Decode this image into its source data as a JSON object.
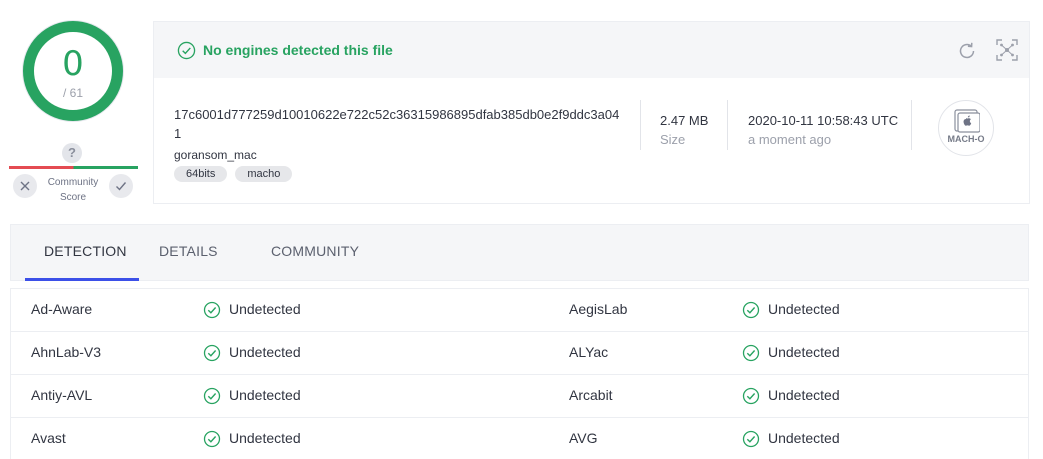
{
  "score": {
    "detections": "0",
    "total": "/ 61",
    "community_question": "?",
    "community_label_line1": "Community",
    "community_label_line2": "Score"
  },
  "summary": {
    "status_text": "No engines detected this file",
    "hash": "17c6001d777259d10010622e722c52c36315986895dfab385db0e2f9ddc3a041",
    "file_name": "goransom_mac",
    "tags": [
      "64bits",
      "macho"
    ],
    "size_value": "2.47 MB",
    "size_label": "Size",
    "date_value": "2020-10-11 10:58:43 UTC",
    "date_relative": "a moment ago",
    "file_type": "MACH-O"
  },
  "tabs": [
    {
      "label": "DETECTION",
      "active": true
    },
    {
      "label": "DETAILS",
      "active": false
    },
    {
      "label": "COMMUNITY",
      "active": false
    }
  ],
  "detections": [
    {
      "left_engine": "Ad-Aware",
      "left_result": "Undetected",
      "right_engine": "AegisLab",
      "right_result": "Undetected"
    },
    {
      "left_engine": "AhnLab-V3",
      "left_result": "Undetected",
      "right_engine": "ALYac",
      "right_result": "Undetected"
    },
    {
      "left_engine": "Antiy-AVL",
      "left_result": "Undetected",
      "right_engine": "Arcabit",
      "right_result": "Undetected"
    },
    {
      "left_engine": "Avast",
      "left_result": "Undetected",
      "right_engine": "AVG",
      "right_result": "Undetected"
    }
  ],
  "colors": {
    "clean_green": "#28a361",
    "malicious_red": "#e44b52",
    "tab_accent": "#3c50e8"
  },
  "icons": {
    "status": "check-circle-icon",
    "reanalyze": "refresh-icon",
    "graph": "graph-expand-icon",
    "file_type": "apple-file-icon",
    "vote_down": "close-icon",
    "vote_up": "check-icon",
    "result": "check-circle-icon"
  }
}
